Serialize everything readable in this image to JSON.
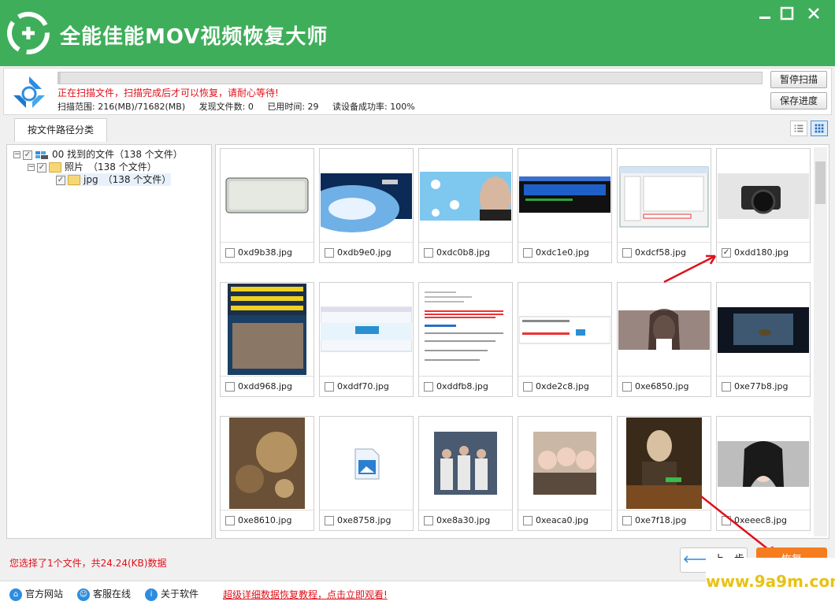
{
  "app": {
    "title": "全能佳能MOV视频恢复大师",
    "accent": "#3fae5a"
  },
  "window_controls": {
    "minimize": "minimize-icon",
    "maximize": "maximize-icon",
    "close": "close-icon"
  },
  "scan": {
    "progress_fraction": 0.003,
    "message": "正在扫描文件，扫描完成后才可以恢复，请耐心等待!",
    "range": "扫描范围: 216(MB)/71682(MB)",
    "found": "发现文件数: 0",
    "elapsed": "已用时间: 29",
    "read_rate": "读设备成功率: 100%",
    "pause_label": "暂停扫描",
    "save_label": "保存进度"
  },
  "tabs": [
    {
      "label": "按文件路径分类"
    }
  ],
  "tree": [
    {
      "label": "00 找到的文件（138 个文件）"
    },
    {
      "label": "照片　（138 个文件）"
    },
    {
      "label": "jpg　（138 个文件）"
    }
  ],
  "files": [
    {
      "name": "0xd9b38.jpg",
      "checked": false,
      "thumb": "joo-seng"
    },
    {
      "name": "0xdb9e0.jpg",
      "checked": false,
      "thumb": "space"
    },
    {
      "name": "0xdc0b8.jpg",
      "checked": false,
      "thumb": "twitter"
    },
    {
      "name": "0xdc1e0.jpg",
      "checked": false,
      "thumb": "windows"
    },
    {
      "name": "0xdcf58.jpg",
      "checked": false,
      "thumb": "dialog"
    },
    {
      "name": "0xdd180.jpg",
      "checked": true,
      "thumb": "camera"
    },
    {
      "name": "0xdd968.jpg",
      "checked": false,
      "thumb": "poster"
    },
    {
      "name": "0xddf70.jpg",
      "checked": false,
      "thumb": "webpage"
    },
    {
      "name": "0xddfb8.jpg",
      "checked": false,
      "thumb": "doc"
    },
    {
      "name": "0xde2c8.jpg",
      "checked": false,
      "thumb": "form"
    },
    {
      "name": "0xe6850.jpg",
      "checked": false,
      "thumb": "woman"
    },
    {
      "name": "0xe77b8.jpg",
      "checked": false,
      "thumb": "lake"
    },
    {
      "name": "0xe8610.jpg",
      "checked": false,
      "thumb": "map"
    },
    {
      "name": "0xe8758.jpg",
      "checked": false,
      "thumb": "placeholder"
    },
    {
      "name": "0xe8a30.jpg",
      "checked": false,
      "thumb": "astronauts"
    },
    {
      "name": "0xeaca0.jpg",
      "checked": false,
      "thumb": "group"
    },
    {
      "name": "0xe7f18.jpg",
      "checked": false,
      "thumb": "painting"
    },
    {
      "name": "0xeeec8.jpg",
      "checked": false,
      "thumb": "portrait"
    }
  ],
  "status": "您选择了1个文件，共24.24(KB)数据",
  "buttons": {
    "prev": "上一步",
    "recover": "恢复"
  },
  "footer": {
    "website": "官方网站",
    "support": "客服在线",
    "about": "关于软件",
    "tutorial": "超级详细数据恢复教程，点击立即观看!"
  },
  "watermark": "www.9a9m.com"
}
